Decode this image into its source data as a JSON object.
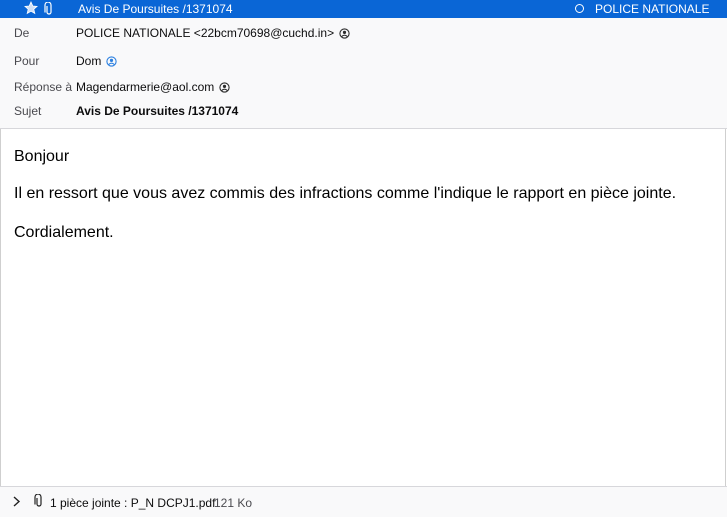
{
  "message_bar": {
    "subject": "Avis De Poursuites /1371074",
    "sender": "POLICE NATIONALE",
    "star_icon": "star-icon",
    "attachment_icon": "paperclip-icon",
    "unread_icon": "status-dot-icon"
  },
  "headers": {
    "from": {
      "label": "De",
      "value": "POLICE NATIONALE <22bcm70698@cuchd.in>"
    },
    "to": {
      "label": "Pour",
      "value": "Dom"
    },
    "reply_to": {
      "label": "Réponse à",
      "value": "Magendarmerie@aol.com"
    },
    "subject": {
      "label": "Sujet",
      "value": "Avis De Poursuites /1371074"
    }
  },
  "body": {
    "greeting": "Bonjour",
    "line1": "Il en ressort que vous avez commis des infractions comme l'indique le rapport en pièce jointe.",
    "closing": "Cordialement."
  },
  "attachments": {
    "summary": "1 pièce jointe : P_N DCPJ1.pdf",
    "size": "121 Ko",
    "expand_icon": "chevron-right-icon",
    "attachment_icon": "paperclip-icon"
  },
  "colors": {
    "selection_blue": "#0a66d6",
    "contact_blue": "#2a7fe0",
    "header_bg": "#f9f9fa"
  }
}
